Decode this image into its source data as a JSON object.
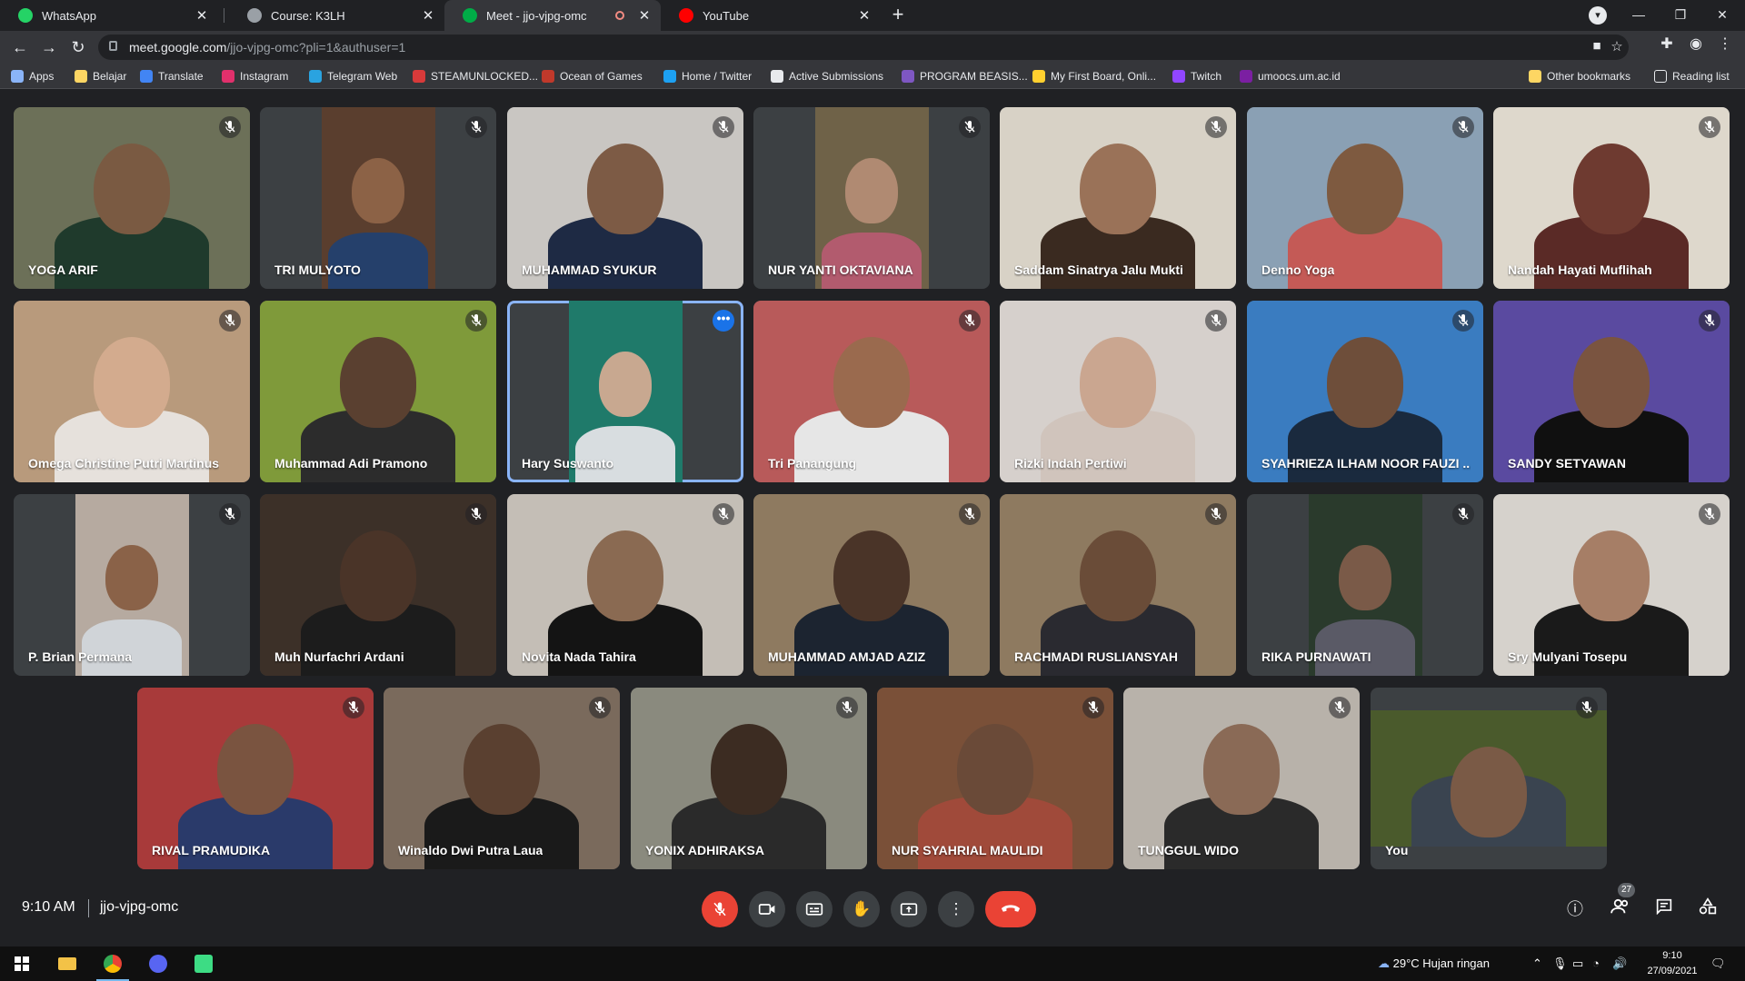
{
  "browser": {
    "tabs": [
      {
        "label": "WhatsApp",
        "favicon": "whatsapp-icon",
        "color": "#25d366"
      },
      {
        "label": "Course: K3LH",
        "favicon": "course-icon",
        "color": "#9aa0a6"
      },
      {
        "label": "Meet - jjo-vjpg-omc",
        "favicon": "meet-icon",
        "color": "#00ac47",
        "active": true,
        "recording": true
      },
      {
        "label": "YouTube",
        "favicon": "youtube-icon",
        "color": "#ff0000"
      }
    ],
    "url": {
      "domain": "meet.google.com",
      "path": "/jjo-vjpg-omc?pli=1&authuser=1"
    },
    "bookmarks": [
      {
        "label": "Apps",
        "icon": "apps-grid-icon",
        "color": "#8ab4f8"
      },
      {
        "label": "Belajar",
        "icon": "folder-icon",
        "color": "#fdd663"
      },
      {
        "label": "Translate",
        "icon": "translate-icon",
        "color": "#4285f4"
      },
      {
        "label": "Instagram",
        "icon": "instagram-icon",
        "color": "#e1306c"
      },
      {
        "label": "Telegram Web",
        "icon": "telegram-icon",
        "color": "#2aa3e0"
      },
      {
        "label": "STEAMUNLOCKED...",
        "icon": "steam-icon",
        "color": "#d83a3a"
      },
      {
        "label": "Ocean of Games",
        "icon": "game-icon",
        "color": "#c0392b"
      },
      {
        "label": "Home / Twitter",
        "icon": "twitter-icon",
        "color": "#1da1f2"
      },
      {
        "label": "Active Submissions",
        "icon": "submissions-icon",
        "color": "#e8eaed"
      },
      {
        "label": "PROGRAM BEASIS...",
        "icon": "form-icon",
        "color": "#7e57c2"
      },
      {
        "label": "My First Board, Onli...",
        "icon": "miro-icon",
        "color": "#ffd02f"
      },
      {
        "label": "Twitch",
        "icon": "twitch-icon",
        "color": "#9146ff"
      },
      {
        "label": "umoocs.um.ac.id",
        "icon": "umoocs-icon",
        "color": "#7b1fa2"
      }
    ],
    "other_bookmarks": "Other bookmarks",
    "reading_list": "Reading list"
  },
  "meet": {
    "participants": [
      {
        "name": "YOGA ARIF",
        "bg": "#6c7058",
        "skin": "#7a5a42",
        "shirt": "#1f3a2c"
      },
      {
        "name": "TRI MULYOTO",
        "bg": "#5a3e2e",
        "skin": "#8c6246",
        "shirt": "#25406b",
        "narrow": true
      },
      {
        "name": "MUHAMMAD SYUKUR",
        "bg": "#c9c6c2",
        "skin": "#7d5b45",
        "shirt": "#1e2a44"
      },
      {
        "name": "NUR YANTI OKTAVIANA",
        "bg": "#6f6248",
        "skin": "#b08a72",
        "shirt": "#b25b6e",
        "narrow": true
      },
      {
        "name": "Saddam Sinatrya Jalu Mukti",
        "bg": "#d8d2c6",
        "skin": "#9a7258",
        "shirt": "#3a2a20"
      },
      {
        "name": "Denno Yoga",
        "bg": "#8aa0b4",
        "skin": "#7e5a40",
        "shirt": "#c45a56"
      },
      {
        "name": "Nandah Hayati Muflihah",
        "bg": "#ded8cc",
        "skin": "#6e3a30",
        "shirt": "#5a2a26"
      },
      {
        "name": "Omega Christine Putri Martinus",
        "bg": "#b89a7c",
        "skin": "#d3ab8e",
        "shirt": "#e6e1dc"
      },
      {
        "name": "Muhammad Adi Pramono",
        "bg": "#7f9a3a",
        "skin": "#5a4030",
        "shirt": "#2c2c2c"
      },
      {
        "name": "Hary Suswanto",
        "bg": "#1f7a6a",
        "skin": "#c8a890",
        "shirt": "#d8dde0",
        "narrow": true,
        "speaking": true
      },
      {
        "name": "Tri Panangung",
        "bg": "#b85a5a",
        "skin": "#9a6a4e",
        "shirt": "#e6e6e6"
      },
      {
        "name": "Rizki Indah Pertiwi",
        "bg": "#d6d0cc",
        "skin": "#caa690",
        "shirt": "#d0c4bc"
      },
      {
        "name": "SYAHRIEZA ILHAM NOOR FAUZI ...",
        "bg": "#3a7cc0",
        "skin": "#6e4e3a",
        "shirt": "#1a2a3e"
      },
      {
        "name": "SANDY SETYAWAN",
        "bg": "#5a4aa0",
        "skin": "#7a5440",
        "shirt": "#101010"
      },
      {
        "name": "P. Brian Permana",
        "bg": "#b6aaa0",
        "skin": "#8a6248",
        "shirt": "#d0d4d8",
        "narrow": true
      },
      {
        "name": "Muh Nurfachri Ardani",
        "bg": "#3c3028",
        "skin": "#4a3428",
        "shirt": "#1c1c1c"
      },
      {
        "name": "Novita Nada Tahira",
        "bg": "#c4beb6",
        "skin": "#8a6a52",
        "shirt": "#141414"
      },
      {
        "name": "MUHAMMAD AMJAD AZIZ",
        "bg": "#8e7a60",
        "skin": "#4a3428",
        "shirt": "#1c2430"
      },
      {
        "name": "RACHMADI RUSLIANSYAH",
        "bg": "#8e7a60",
        "skin": "#6a4c38",
        "shirt": "#2a2a30"
      },
      {
        "name": "RIKA PURNAWATI",
        "bg": "#2a3a2c",
        "skin": "#7a5a48",
        "shirt": "#5a5a66",
        "narrow": true
      },
      {
        "name": "Sry Mulyani Tosepu",
        "bg": "#d6d2cc",
        "skin": "#a67e66",
        "shirt": "#1a1a1a"
      },
      {
        "name": "RIVAL PRAMUDIKA",
        "bg": "#a83a3a",
        "skin": "#7a5440",
        "shirt": "#2a3a6a"
      },
      {
        "name": "Winaldo Dwi Putra Laua",
        "bg": "#7a6a5c",
        "skin": "#5a4030",
        "shirt": "#1a1a1a"
      },
      {
        "name": "YONIX ADHIRAKSA",
        "bg": "#8a8a7e",
        "skin": "#3c2c22",
        "shirt": "#2a2a2a"
      },
      {
        "name": "NUR SYAHRIAL MAULIDI",
        "bg": "#7a5038",
        "skin": "#6a4a38",
        "shirt": "#a04a3a"
      },
      {
        "name": "TUNGGUL WIDO",
        "bg": "#b8b2aa",
        "skin": "#8a6a56",
        "shirt": "#2a2a2a"
      },
      {
        "name": "You",
        "bg": "#4a5a2c",
        "skin": "#7a5a46",
        "shirt": "#3a4450",
        "self": true
      }
    ],
    "time": "9:10 AM",
    "meeting_code": "jjo-vjpg-omc",
    "participant_count": "27"
  },
  "taskbar": {
    "weather": "29°C  Hujan ringan",
    "time": "9:10",
    "date": "27/09/2021"
  }
}
